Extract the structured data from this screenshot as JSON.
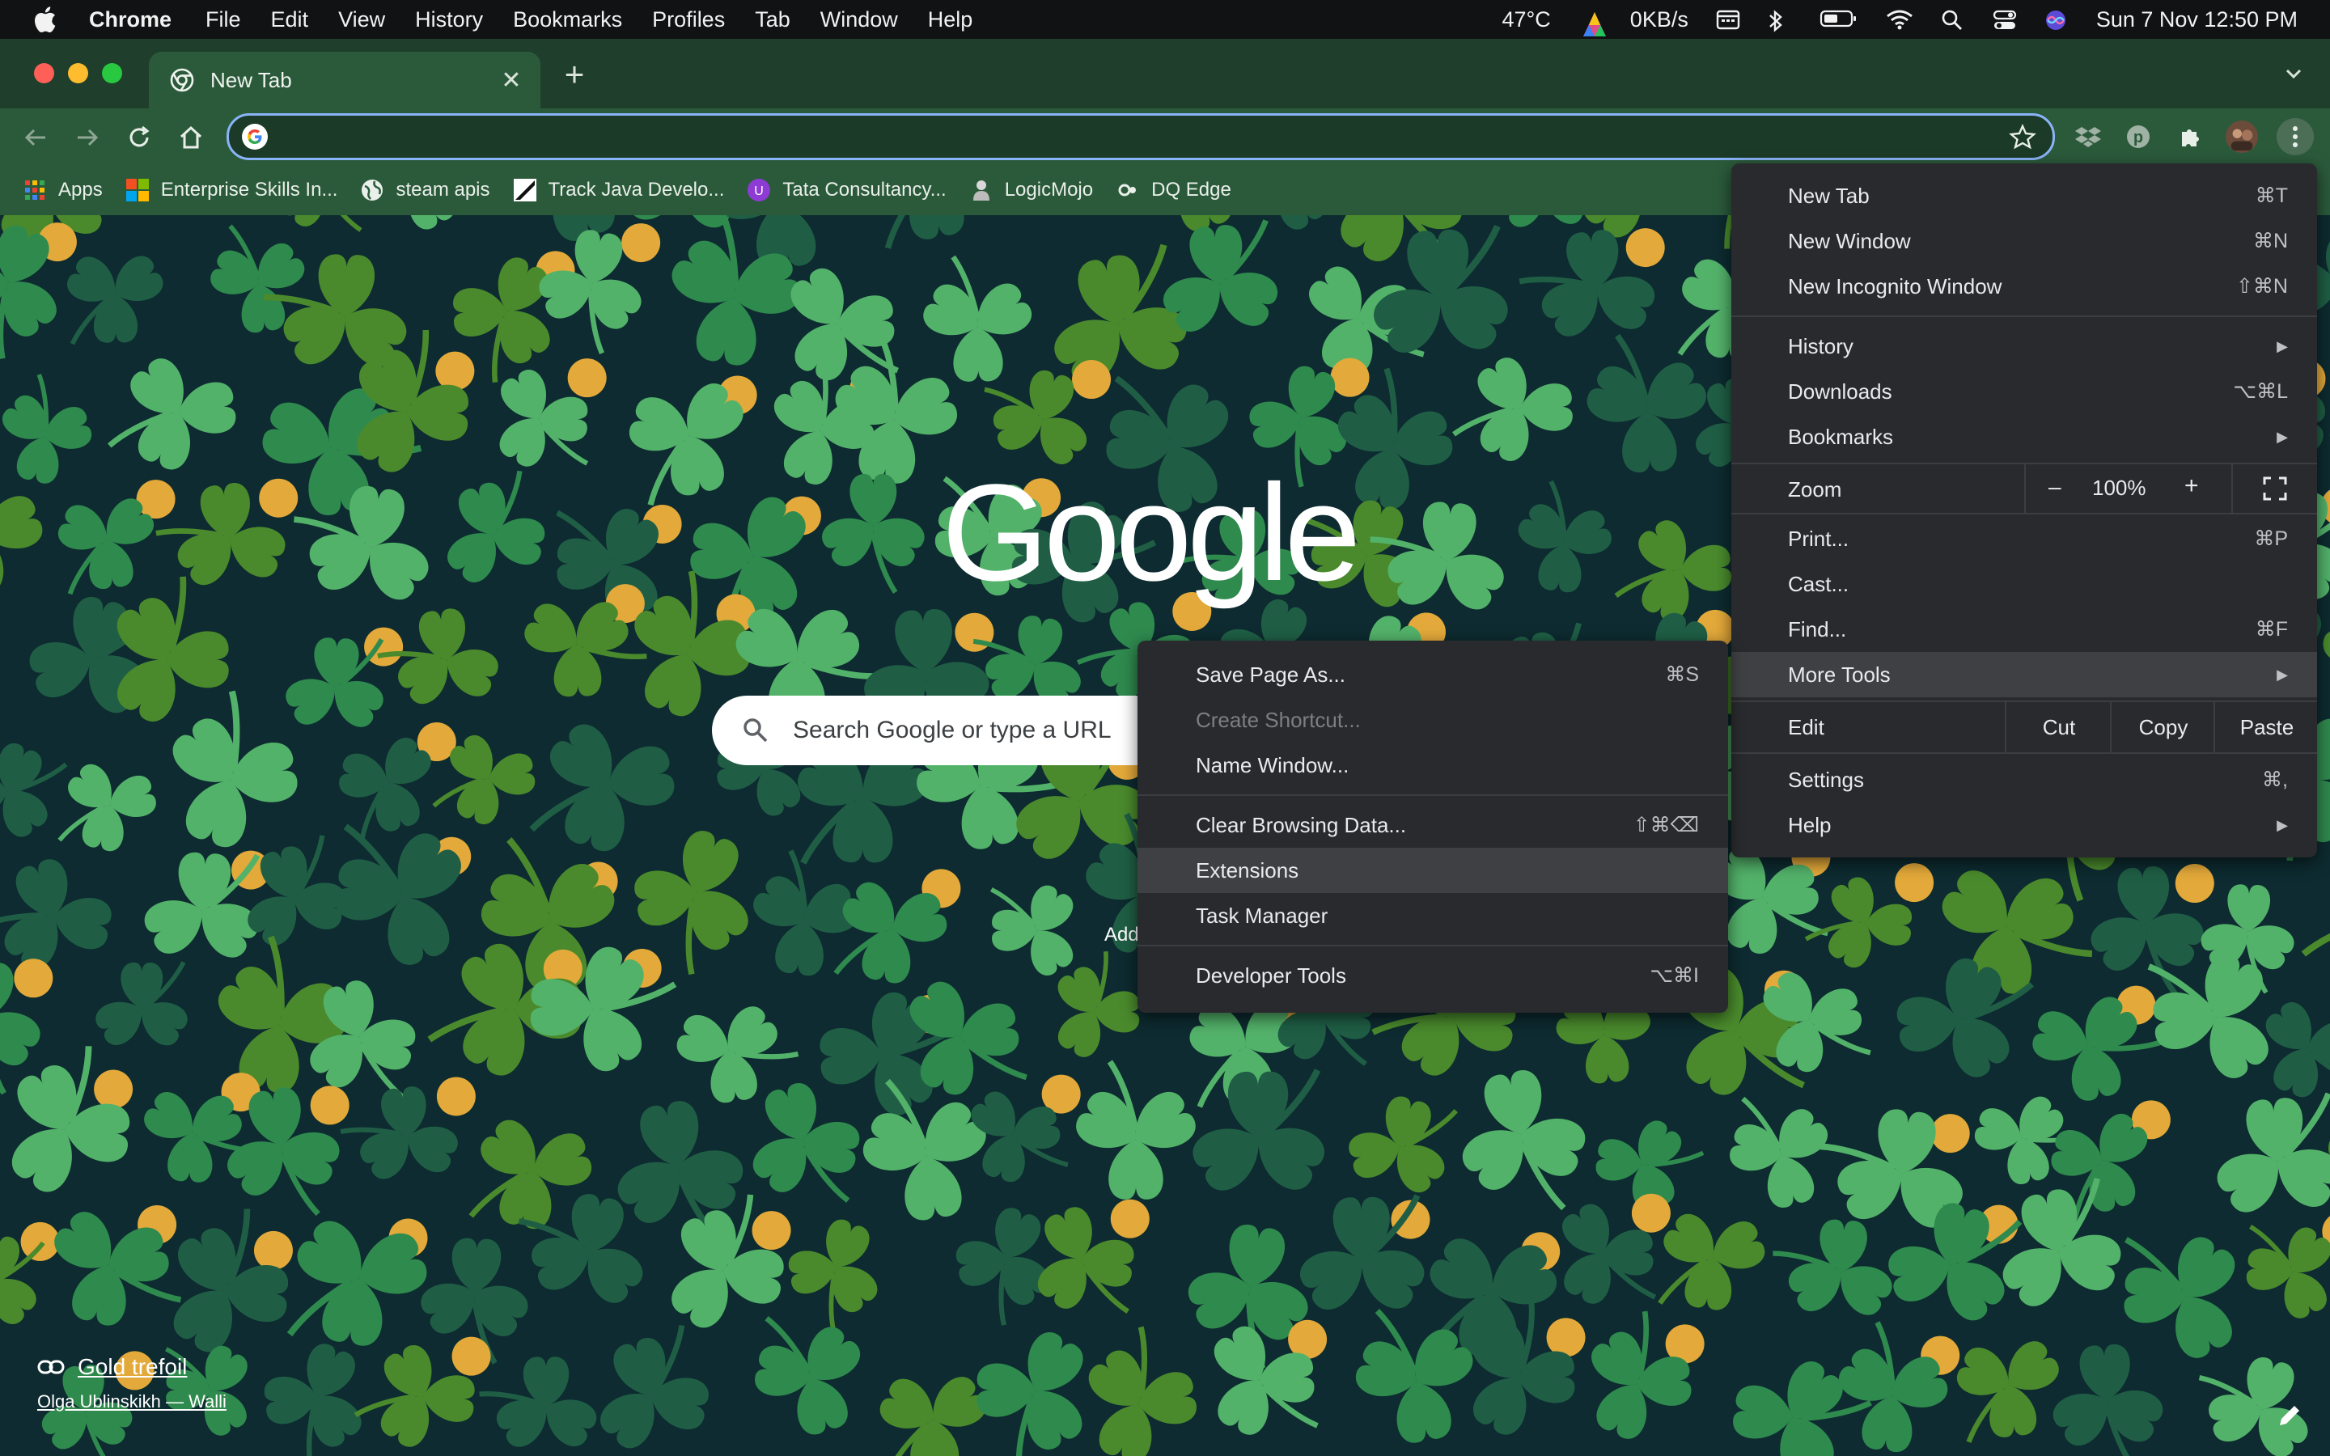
{
  "menubar": {
    "app_name": "Chrome",
    "menus": [
      "File",
      "Edit",
      "View",
      "History",
      "Bookmarks",
      "Profiles",
      "Tab",
      "Window",
      "Help"
    ],
    "temperature": "47°C",
    "network_speed": "0KB/s",
    "datetime": "Sun 7 Nov  12:50 PM"
  },
  "tab": {
    "title": "New Tab"
  },
  "omnibox": {
    "value": ""
  },
  "bookmarks": [
    {
      "label": "Apps",
      "icon": "apps-grid-icon"
    },
    {
      "label": "Enterprise Skills In...",
      "icon": "microsoft-logo-icon"
    },
    {
      "label": "steam apis",
      "icon": "globe-icon"
    },
    {
      "label": "Track Java Develo...",
      "icon": "track-icon"
    },
    {
      "label": "Tata Consultancy...",
      "icon": "tata-icon"
    },
    {
      "label": "LogicMojo",
      "icon": "logicmojo-icon"
    },
    {
      "label": "DQ Edge",
      "icon": "dq-icon"
    }
  ],
  "page": {
    "logo_text": "Google",
    "search_placeholder": "Search Google or type a URL",
    "shortcut_label": "Add",
    "attribution_title": "Gold trefoil",
    "attribution_author": "Olga Ublinskikh — Walli"
  },
  "chrome_menu": {
    "new_tab": {
      "label": "New Tab",
      "shortcut": "⌘T"
    },
    "new_window": {
      "label": "New Window",
      "shortcut": "⌘N"
    },
    "new_incognito": {
      "label": "New Incognito Window",
      "shortcut": "⇧⌘N"
    },
    "history": {
      "label": "History"
    },
    "downloads": {
      "label": "Downloads",
      "shortcut": "⌥⌘L"
    },
    "bookmarks": {
      "label": "Bookmarks"
    },
    "zoom": {
      "label": "Zoom",
      "minus": "–",
      "value": "100%",
      "plus": "+"
    },
    "print": {
      "label": "Print...",
      "shortcut": "⌘P"
    },
    "cast": {
      "label": "Cast..."
    },
    "find": {
      "label": "Find...",
      "shortcut": "⌘F"
    },
    "more_tools": {
      "label": "More Tools"
    },
    "edit": {
      "label": "Edit",
      "cut": "Cut",
      "copy": "Copy",
      "paste": "Paste"
    },
    "settings": {
      "label": "Settings",
      "shortcut": "⌘,"
    },
    "help": {
      "label": "Help"
    }
  },
  "more_tools_menu": {
    "save_page": {
      "label": "Save Page As...",
      "shortcut": "⌘S"
    },
    "create_shortcut": {
      "label": "Create Shortcut..."
    },
    "name_window": {
      "label": "Name Window..."
    },
    "clear_data": {
      "label": "Clear Browsing Data...",
      "shortcut": "⇧⌘⌫"
    },
    "extensions": {
      "label": "Extensions"
    },
    "task_manager": {
      "label": "Task Manager"
    },
    "dev_tools": {
      "label": "Developer Tools",
      "shortcut": "⌥⌘I"
    }
  },
  "colors": {
    "clover_dark": "#1f5e45",
    "clover_mid": "#2f8a4e",
    "clover_light": "#53b26a",
    "clover_olive": "#4a8a2c",
    "coin": "#e3a93a",
    "menu_bg": "#292a2d",
    "menu_highlight": "#3f4043",
    "focus_ring": "#8ab4f8"
  }
}
